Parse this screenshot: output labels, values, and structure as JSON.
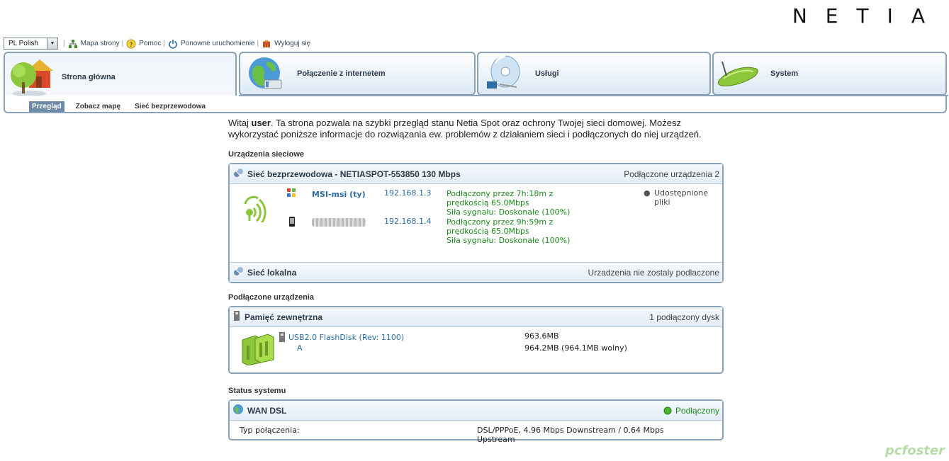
{
  "brand": {
    "logo": "NETIA"
  },
  "topbar": {
    "language": "PL Polish",
    "links": [
      {
        "label": "Mapa strony",
        "icon": "sitemap-icon"
      },
      {
        "label": "Pomoc",
        "icon": "help-icon"
      },
      {
        "label": "Ponowne uruchomienie",
        "icon": "power-icon"
      },
      {
        "label": "Wyloguj się",
        "icon": "logout-icon"
      }
    ]
  },
  "tabs": [
    {
      "label": "Strona główna",
      "icon": "home-icon",
      "active": true
    },
    {
      "label": "Połączenie z internetem",
      "icon": "globe-icon",
      "active": false
    },
    {
      "label": "Usługi",
      "icon": "services-disc-icon",
      "active": false
    },
    {
      "label": "System",
      "icon": "router-icon",
      "active": false
    }
  ],
  "subnav": [
    {
      "label": "Przegląd",
      "active": true
    },
    {
      "label": "Zobacz mapę",
      "active": false
    },
    {
      "label": "Sieć bezprzewodowa",
      "active": false
    }
  ],
  "intro": {
    "before": "Witaj ",
    "user": "user",
    "after": ". Ta strona pozwala na szybki przegląd stanu Netia Spot oraz ochrony Twojej sieci domowej. Możesz wykorzystać poniższe informacje do rozwiązania ew. problemów z działaniem sieci i podłączonych do niej urządzeń."
  },
  "sections": {
    "network_devices": "Urządzenia sieciowe",
    "connected_devices": "Podłączone urządzenia",
    "system_status": "Status systemu"
  },
  "wireless": {
    "title": "Sieć bezprzewodowa - NETIASPOT-553850 130 Mbps",
    "right": "Podłączone urządzenia 2",
    "devices": [
      {
        "name": "MSI-msi (ty)",
        "ip": "192.168.1.3",
        "status1": "Podłączony przez 7h:18m z",
        "status2": "prędkością 65.0Mbps",
        "status3": "Siła sygnału: Doskonałe (100%)"
      },
      {
        "name": "",
        "ip": "192.168.1.4",
        "status1": "Podłączony przez 9h:59m z",
        "status2": "prędkością 65.0Mbps",
        "status3": "Siła sygnału: Doskonałe (100%)"
      }
    ],
    "shared": "Udostępnione pliki"
  },
  "lan": {
    "title": "Sieć lokalna",
    "right": "Urzadzenia nie zostaly podlaczone"
  },
  "storage": {
    "title": "Pamięć zewnętrzna",
    "right": "1 podłączony dysk",
    "disk_name": "USB2.0 FlashDisk (Rev: 1100)",
    "partition": "A",
    "size": "963.6MB",
    "free": "964.2MB (964.1MB wolny)"
  },
  "wan": {
    "title": "WAN DSL",
    "status": "Podłączony",
    "conn_label": "Typ połączenia:",
    "conn_value1": "DSL/PPPoE, 4.96 Mbps Downstream / 0.64 Mbps",
    "conn_value2": "Upstream"
  },
  "watermark": "pcfoster",
  "colors": {
    "border": "#8aa2b8",
    "link": "#2e6ca4",
    "ok": "#1e8a1e"
  }
}
